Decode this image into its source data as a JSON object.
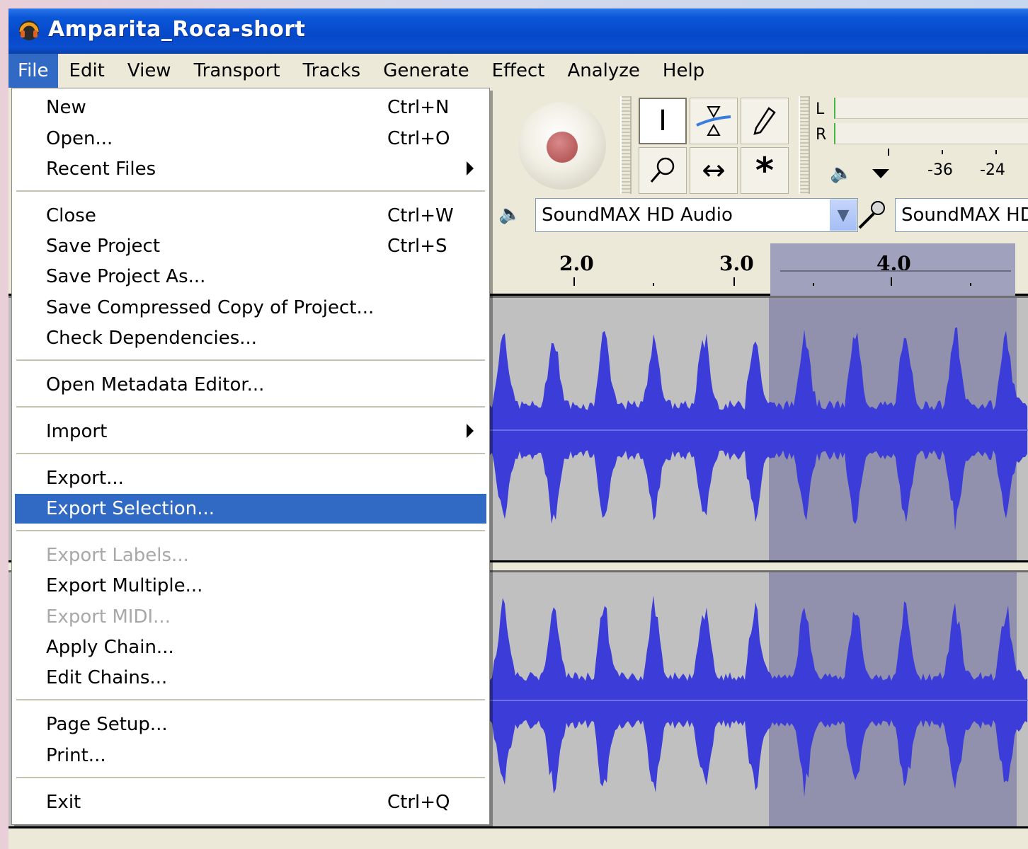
{
  "window": {
    "title": "Amparita_Roca-short"
  },
  "menubar": [
    "File",
    "Edit",
    "View",
    "Transport",
    "Tracks",
    "Generate",
    "Effect",
    "Analyze",
    "Help"
  ],
  "file_menu": {
    "items": [
      {
        "label": "New",
        "shortcut": "Ctrl+N"
      },
      {
        "label": "Open...",
        "shortcut": "Ctrl+O"
      },
      {
        "label": "Recent Files",
        "shortcut": ""
      },
      {
        "label": "Close",
        "shortcut": "Ctrl+W"
      },
      {
        "label": "Save Project",
        "shortcut": "Ctrl+S"
      },
      {
        "label": "Save Project As...",
        "shortcut": ""
      },
      {
        "label": "Save Compressed Copy of Project...",
        "shortcut": ""
      },
      {
        "label": "Check Dependencies...",
        "shortcut": ""
      },
      {
        "label": "Open Metadata Editor...",
        "shortcut": ""
      },
      {
        "label": "Import",
        "shortcut": ""
      },
      {
        "label": "Export...",
        "shortcut": ""
      },
      {
        "label": "Export Selection...",
        "shortcut": ""
      },
      {
        "label": "Export Labels...",
        "shortcut": ""
      },
      {
        "label": "Export Multiple...",
        "shortcut": ""
      },
      {
        "label": "Export MIDI...",
        "shortcut": ""
      },
      {
        "label": "Apply Chain...",
        "shortcut": ""
      },
      {
        "label": "Edit Chains...",
        "shortcut": ""
      },
      {
        "label": "Page Setup...",
        "shortcut": ""
      },
      {
        "label": "Print...",
        "shortcut": ""
      },
      {
        "label": "Exit",
        "shortcut": "Ctrl+Q"
      }
    ],
    "highlighted": "Export Selection...",
    "disabled": [
      "Export Labels...",
      "Export MIDI..."
    ]
  },
  "meter": {
    "channels": [
      "L",
      "R"
    ],
    "scale": [
      "-36",
      "-24"
    ]
  },
  "devices": {
    "output": "SoundMAX HD Audio",
    "input": "SoundMAX HD"
  },
  "ruler": {
    "labels": [
      "2.0",
      "3.0",
      "4.0"
    ]
  },
  "colors": {
    "waveform": "#3c3cd8",
    "selection": "#9191ad",
    "menu_highlight": "#316ac5",
    "titlebar": "#0a56d8"
  }
}
